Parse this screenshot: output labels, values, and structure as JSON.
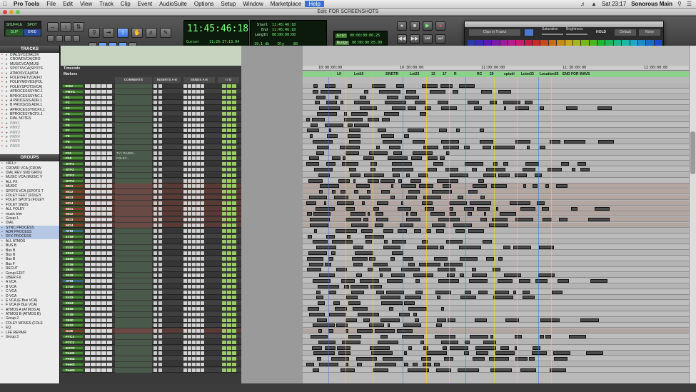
{
  "menubar": {
    "app": "Pro Tools",
    "items": [
      "File",
      "Edit",
      "View",
      "Track",
      "Clip",
      "Event",
      "AudioSuite",
      "Options",
      "Setup",
      "Window",
      "Marketplace",
      "Help"
    ],
    "active": "Help",
    "clock": "Sat 23:17",
    "user": "Sonorous Main"
  },
  "window": {
    "title": "Edit: FOR SCREENSHOTS"
  },
  "toolbar": {
    "modes": [
      "SHUFFLE",
      "SPOT",
      "SLIP",
      "GRID"
    ],
    "main_counter": "11:45:46:18",
    "cursor_label": "Cursor",
    "cursor_value": "11:25:37:13.04",
    "level_value": "-19.1 db",
    "dly_label": "Dly",
    "dly_value": "80",
    "sel": [
      {
        "k": "Start",
        "v": "11:45:46:18"
      },
      {
        "k": "End",
        "v": "11:45:46:18"
      },
      {
        "k": "Length",
        "v": "00:00:00:00"
      }
    ],
    "grid_label": "Grid",
    "grid_value": "00:00:00:00.25",
    "nudge_label": "Nudge",
    "nudge_value": "00:00:00:05.00"
  },
  "palette": {
    "mode": "Clips in Tracks",
    "saturation_label": "Saturation",
    "brightness_label": "Brightness",
    "hold_label": "HOLD",
    "default_label": "Default",
    "none_label": "None",
    "swatches": [
      "#2a3aa8",
      "#3a2ab8",
      "#5a1ab8",
      "#7a1aa8",
      "#9a1aa0",
      "#b81a90",
      "#c81a70",
      "#c81a4a",
      "#c82a2a",
      "#c84a1a",
      "#c86a1a",
      "#c88a1a",
      "#c8a81a",
      "#a8b81a",
      "#7ab81a",
      "#4ab81a",
      "#1ab82a",
      "#1ab85a",
      "#1ab88a",
      "#1ab8a8",
      "#1aa8c8",
      "#1a8ac8",
      "#1a6ac8",
      "#1a4ac8"
    ]
  },
  "tracks_panel": {
    "title": "TRACKS",
    "items": [
      "DIALSVC(DIALSV",
      "CROWDVCA(CRO",
      "MUSICVCA(MUSI",
      "SPOTSVCA(SPOTS",
      "ATMOSVCA(ATM",
      "FOLEYFETVCA(FO",
      "FOLEYMOVES(FOL",
      "FOLEYSPOTSVCA(",
      "APROCESSSYNC.1",
      "BPROCESSSYNC.1",
      "A PROCESS ADR.1",
      "B PROCESS ADR.1",
      "APROCESSYNCFX.1",
      "BPROCESYNCFX.1",
      "DIAL NOTES",
      "PMX1",
      "PMX2",
      "PMX3",
      "PMX4",
      "PMX5",
      "PMX6"
    ]
  },
  "groups_panel": {
    "title": "GROUPS",
    "items": [
      "<ALL>",
      "CROWD VCA (CROW",
      "DIAL REV SND GROU",
      "MUSIC VCA (MUSIC V",
      "ALL FX",
      "MUSIC",
      "SPOTS VCA (SPOTS T",
      "FOLEY FEET (FOLEY",
      "FOLEY SPOTS (FOLEY",
      "FOLEY SNDS",
      "ALL FOLEY",
      "music trim",
      "Group 1",
      "DIAL",
      "SYNC PROCESS",
      "ADR PROCESS",
      "DFX PROCESS",
      "ALL ATMOS",
      "BUS B",
      "Bus B",
      "Bus B",
      "Bus B",
      "Bus F",
      "RECUT",
      "Group EDIT",
      "UBER FX",
      "A VCA",
      "B VCA",
      "C VCA",
      "D VCA",
      "E VCA (E Bus VCA)",
      "F VCA (F Bus VCA)",
      "ATMOS A (ATMOS A)",
      "ATMOS B (ATMOS B)",
      "Group 2",
      "FOLEY MOVES (FOLE",
      "EQ",
      "LFE REPAIR",
      "Group 3"
    ]
  },
  "mix": {
    "ruler_timecode": "Timecode",
    "ruler_markers": "Markers",
    "col_comments": "COMMENTS",
    "col_inserts": "INSERTS A-E",
    "col_sends": "SENDS A-E",
    "col_io": "I / O",
    "tracks": [
      {
        "name": "ESU",
        "color": "#4c8c3a",
        "comment": ""
      },
      {
        "name": "FBVC",
        "color": "#4c8c3a",
        "comment": ""
      },
      {
        "name": "F1",
        "color": "#4c8c3a",
        "comment": ""
      },
      {
        "name": "F2",
        "color": "#4c8c3a",
        "comment": ""
      },
      {
        "name": "F3",
        "color": "#4c8c3a",
        "comment": ""
      },
      {
        "name": "F4",
        "color": "#4c8c3a",
        "comment": ""
      },
      {
        "name": "F5",
        "color": "#4c8c3a",
        "comment": ""
      },
      {
        "name": "F6",
        "color": "#4c8c3a",
        "comment": ""
      },
      {
        "name": "F7",
        "color": "#4c8c3a",
        "comment": ""
      },
      {
        "name": "F8",
        "color": "#4c8c3a",
        "comment": ""
      },
      {
        "name": "F9",
        "color": "#4c8c3a",
        "comment": ""
      },
      {
        "name": "F10",
        "color": "#4c8c3a",
        "comment": ""
      },
      {
        "name": "F11",
        "color": "#4c8c3a",
        "comment": "TV / RADIO..."
      },
      {
        "name": "F12",
        "color": "#4c8c3a",
        "comment": "FOLEY..."
      },
      {
        "name": "STF1",
        "color": "#4c8c3a",
        "comment": ""
      },
      {
        "name": "STF2",
        "color": "#4c8c3a",
        "comment": ""
      },
      {
        "name": "STF3",
        "color": "#4c8c3a",
        "comment": ""
      },
      {
        "name": "STF4",
        "color": "#4c8c3a",
        "comment": ""
      },
      {
        "name": "MO1",
        "color": "#8a3a2a",
        "comment": ""
      },
      {
        "name": "MO2",
        "color": "#8a3a2a",
        "comment": ""
      },
      {
        "name": "MO3",
        "color": "#8a3a2a",
        "comment": ""
      },
      {
        "name": "MO4",
        "color": "#8a3a2a",
        "comment": ""
      },
      {
        "name": "MO1",
        "color": "#8a3a2a",
        "comment": ""
      },
      {
        "name": "MO2",
        "color": "#8a3a2a",
        "comment": ""
      },
      {
        "name": "MO3",
        "color": "#8a3a2a",
        "comment": ""
      },
      {
        "name": "MO4",
        "color": "#8a3a2a",
        "comment": ""
      },
      {
        "name": "ATM",
        "color": "#3a6a8a",
        "comment": ""
      },
      {
        "name": "1718",
        "color": "#4c8c3a",
        "comment": ""
      },
      {
        "name": "1920",
        "color": "#4c8c3a",
        "comment": ""
      },
      {
        "name": "2122",
        "color": "#4c8c3a",
        "comment": ""
      },
      {
        "name": "2324",
        "color": "#4c8c3a",
        "comment": ""
      },
      {
        "name": "2526",
        "color": "#4c8c3a",
        "comment": ""
      },
      {
        "name": "2728",
        "color": "#4c8c3a",
        "comment": ""
      },
      {
        "name": "2930",
        "color": "#4c8c3a",
        "comment": ""
      },
      {
        "name": "3132",
        "color": "#4c8c3a",
        "comment": ""
      },
      {
        "name": "ATM",
        "color": "#3a6a8a",
        "comment": ""
      },
      {
        "name": "1718",
        "color": "#4c8c3a",
        "comment": ""
      },
      {
        "name": "1920",
        "color": "#4c8c3a",
        "comment": ""
      },
      {
        "name": "2122",
        "color": "#4c8c3a",
        "comment": ""
      },
      {
        "name": "2324",
        "color": "#4c8c3a",
        "comment": ""
      },
      {
        "name": "2526",
        "color": "#4c8c3a",
        "comment": ""
      },
      {
        "name": "2728",
        "color": "#4c8c3a",
        "comment": ""
      },
      {
        "name": "2930",
        "color": "#4c8c3a",
        "comment": ""
      },
      {
        "name": "3132",
        "color": "#4c8c3a",
        "comment": ""
      },
      {
        "name": "SUB",
        "color": "#8a3a2a",
        "comment": ""
      },
      {
        "name": "FTC1",
        "color": "#4c8c3a",
        "comment": ""
      },
      {
        "name": "FTC2",
        "color": "#4c8c3a",
        "comment": ""
      },
      {
        "name": "EXTP",
        "color": "#4c8c3a",
        "comment": ""
      },
      {
        "name": "Feet1",
        "color": "#4c8c3a",
        "comment": ""
      },
      {
        "name": "Feet2",
        "color": "#4c8c3a",
        "comment": ""
      },
      {
        "name": "Feet3",
        "color": "#4c8c3a",
        "comment": ""
      },
      {
        "name": "Feet4",
        "color": "#4c8c3a",
        "comment": ""
      }
    ]
  },
  "timeline": {
    "ruler": [
      "10:00:00:00",
      "10:30:00:00",
      "11:00:00:00",
      "11:30:00:00",
      "12:00:00:00"
    ],
    "markers": [
      "L9",
      "Lot10",
      "2INDTR",
      "Lot23",
      "13",
      "17",
      "R",
      "RC",
      "29",
      "cpiudi",
      "Lotm33",
      "Location35",
      "END FOR WAVS"
    ]
  }
}
